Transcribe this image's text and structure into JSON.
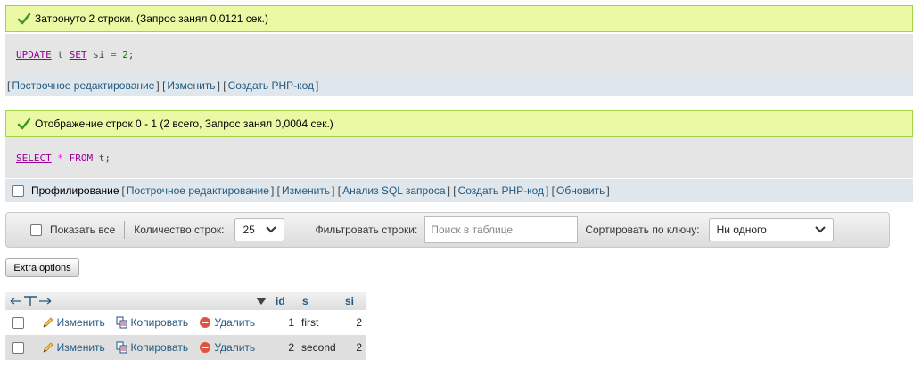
{
  "msg1": {
    "text": "Затронуто 2 строки. (Запрос занял 0,0121 сек.)"
  },
  "sql1": {
    "kw1": "UPDATE",
    "t": " t ",
    "kw2": "SET",
    "col": " si ",
    "op": "=",
    "num": " 2",
    "end": ";"
  },
  "tools1": {
    "inline_edit": "Построчное редактирование",
    "edit": "Изменить",
    "php": "Создать PHP-код"
  },
  "msg2": {
    "text": "Отображение строк 0 - 1 (2 всего, Запрос занял 0,0004 сек.)"
  },
  "sql2": {
    "kw1": "SELECT",
    "star": " * ",
    "kw2": "FROM",
    "rest": " t;"
  },
  "tools2": {
    "profiling": "Профилирование",
    "inline_edit": "Построчное редактирование",
    "edit": "Изменить",
    "analyze": "Анализ SQL запроса",
    "php": "Создать PHP-код",
    "refresh": "Обновить"
  },
  "nav": {
    "show_all": "Показать все",
    "row_count_label": "Количество строк:",
    "row_count_value": "25",
    "filter_label": "Фильтровать строки:",
    "filter_placeholder": "Поиск в таблице",
    "sort_label": "Сортировать по ключу:",
    "sort_value": "Ни одного"
  },
  "extra_options": "Extra options",
  "table": {
    "headers": {
      "id": "id",
      "s": "s",
      "si": "si"
    },
    "actions": {
      "edit": "Изменить",
      "copy": "Копировать",
      "delete": "Удалить"
    },
    "rows": [
      {
        "id": "1",
        "s": "first",
        "si": "2"
      },
      {
        "id": "2",
        "s": "second",
        "si": "2"
      }
    ]
  },
  "colors": {
    "success_bg": "#ebf8a4",
    "link": "#235a81"
  }
}
